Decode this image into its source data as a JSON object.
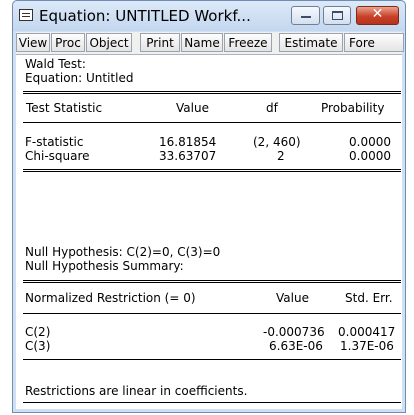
{
  "window": {
    "title": "Equation: UNTITLED   Workf..."
  },
  "toolbar": {
    "buttons": [
      "View",
      "Proc",
      "Object",
      "Print",
      "Name",
      "Freeze",
      "Estimate",
      "Fore"
    ]
  },
  "output": {
    "heading": "Wald Test:",
    "equation": "Equation: Untitled",
    "stats_table": {
      "headers": [
        "Test Statistic",
        "Value",
        "df",
        "Probability"
      ],
      "rows": [
        [
          "F-statistic",
          "16.81854",
          "(2, 460)",
          "0.0000"
        ],
        [
          "Chi-square",
          "33.63707",
          "2",
          "0.0000"
        ]
      ]
    },
    "null_hypothesis": "Null Hypothesis: C(2)=0, C(3)=0",
    "null_summary": "Null Hypothesis Summary:",
    "restriction_table": {
      "headers": [
        "Normalized Restriction (= 0)",
        "Value",
        "Std. Err."
      ],
      "rows": [
        [
          "C(2)",
          "-0.000736",
          "0.000417"
        ],
        [
          "C(3)",
          "6.63E-06",
          "1.37E-06"
        ]
      ]
    },
    "footer": "Restrictions are linear in coefficients."
  }
}
